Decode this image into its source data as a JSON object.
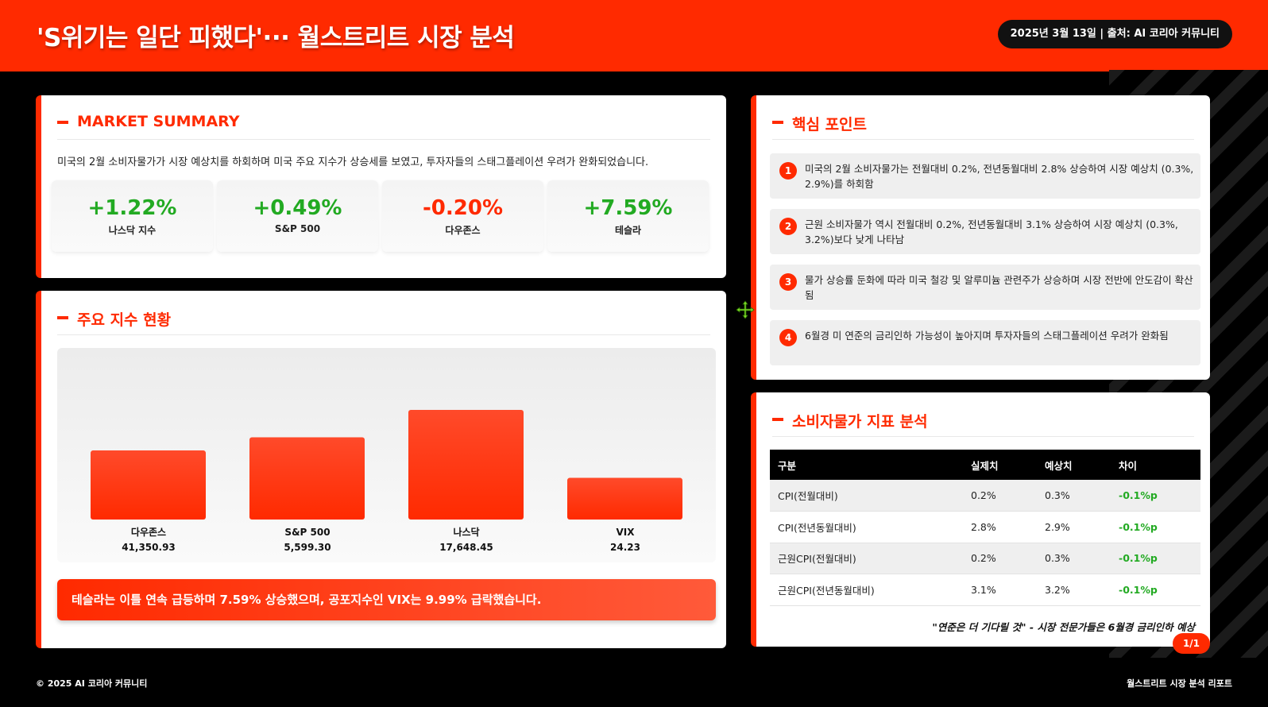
{
  "header": {
    "title": "'S위기는 일단 피했다'··· 월스트리트 시장 분석",
    "meta": "2025년 3월 13일 | 출처: AI 코리아 커뮤니티"
  },
  "summary": {
    "heading": "MARKET SUMMARY",
    "text": "미국의 2월 소비자물가가 시장 예상치를 하회하며 미국 주요 지수가 상승세를 보였고, 투자자들의 스태그플레이션 우려가 완화되었습니다.",
    "stats": [
      {
        "value": "+1.22%",
        "label": "나스닥 지수",
        "direction": "up"
      },
      {
        "value": "+0.49%",
        "label": "S&P 500",
        "direction": "up"
      },
      {
        "value": "-0.20%",
        "label": "다우존스",
        "direction": "down"
      },
      {
        "value": "+7.59%",
        "label": "테슬라",
        "direction": "up"
      }
    ]
  },
  "indices": {
    "heading": "주요 지수 현황",
    "banner": "테슬라는 이틀 연속 급등하며 7.59% 상승했으며, 공포지수인 VIX는 9.99% 급락했습니다."
  },
  "chart_data": {
    "type": "bar",
    "categories": [
      "다우존스",
      "S&P 500",
      "나스닥",
      "VIX"
    ],
    "value_labels": [
      "41,350.93",
      "5,599.30",
      "17,648.45",
      "24.23"
    ],
    "relative_bar_heights": [
      0.63,
      0.75,
      1.0,
      0.38
    ],
    "colors": {
      "bar_top": "#ff4a2a",
      "bar_bottom": "#ff2a00"
    }
  },
  "keypoints": {
    "heading": "핵심 포인트",
    "items": [
      {
        "num": "1",
        "text": "미국의 2월 소비자물가는 전월대비 0.2%, 전년동월대비 2.8% 상승하여 시장 예상치 (0.3%, 2.9%)를 하회함"
      },
      {
        "num": "2",
        "text": "근원 소비자물가 역시 전월대비 0.2%, 전년동월대비 3.1% 상승하여 시장 예상치 (0.3%, 3.2%)보다 낮게 나타남"
      },
      {
        "num": "3",
        "text": "물가 상승률 둔화에 따라 미국 철강 및 알루미늄 관련주가 상승하며 시장 전반에 안도감이 확산됨"
      },
      {
        "num": "4",
        "text": "6월경 미 연준의 금리인하 가능성이 높아지며 투자자들의 스태그플레이션 우려가 완화됨"
      }
    ]
  },
  "cpi": {
    "heading": "소비자물가 지표 분석",
    "columns": [
      "구분",
      "실제치",
      "예상치",
      "차이"
    ],
    "rows": [
      {
        "name": "CPI(전월대비)",
        "actual": "0.2%",
        "expected": "0.3%",
        "diff": "-0.1%p"
      },
      {
        "name": "CPI(전년동월대비)",
        "actual": "2.8%",
        "expected": "2.9%",
        "diff": "-0.1%p"
      },
      {
        "name": "근원CPI(전월대비)",
        "actual": "0.2%",
        "expected": "0.3%",
        "diff": "-0.1%p"
      },
      {
        "name": "근원CPI(전년동월대비)",
        "actual": "3.1%",
        "expected": "3.2%",
        "diff": "-0.1%p"
      }
    ],
    "quote": "\"연준은 더 기다릴 것\" - 시장 전문가들은 6월경 금리인하 예상"
  },
  "page_badge": "1/1",
  "footer": {
    "left": "© 2025 AI 코리아 커뮤니티",
    "right": "월스트리트 시장 분석 리포트"
  },
  "colors": {
    "accent": "#ff2a00",
    "positive": "#22aa22",
    "background": "#000000"
  }
}
